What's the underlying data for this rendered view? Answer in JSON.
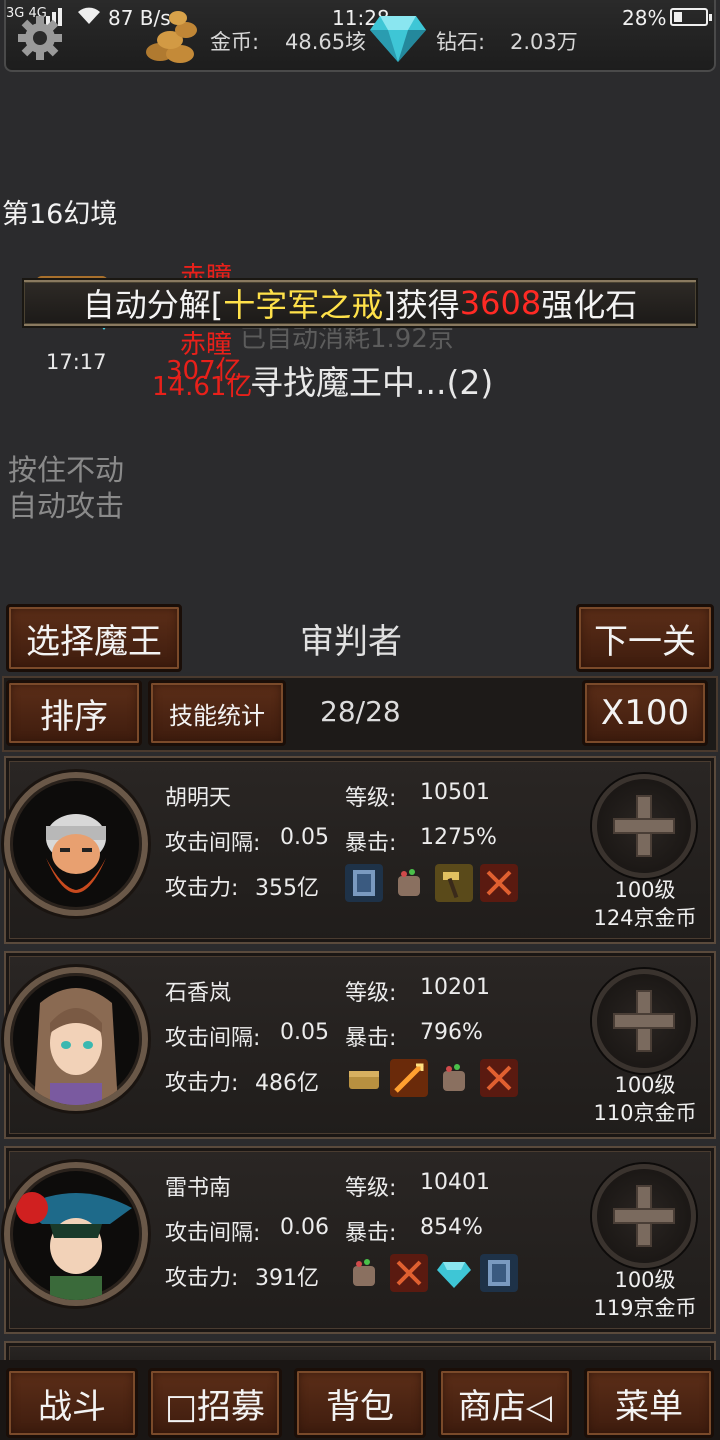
{
  "status": {
    "net": "3G 4G",
    "speed": "87 B/s",
    "time": "11:28",
    "battery": "28%"
  },
  "resources": {
    "gold_label": "金币:",
    "gold_value": "48.65垓",
    "gem_label": "钻石:",
    "gem_value": "2.03万"
  },
  "scene": {
    "level": "第16幻境",
    "chest_time": "17:17",
    "float_1": "赤瞳",
    "float_2": "赤瞳",
    "float_3": "307亿",
    "float_4": "14.61亿",
    "ghost": "已自动消耗1.92京",
    "notice_prefix": "自动分解[",
    "notice_item": "十字军之戒",
    "notice_mid": "]获得",
    "notice_amount": "3608",
    "notice_suffix": "强化石",
    "searching": "寻找魔王中...(2)",
    "hint_line1": "按住不动",
    "hint_line2": "自动攻击"
  },
  "boss": {
    "select_label": "选择魔王",
    "name": "审判者",
    "next_label": "下一关"
  },
  "toolbar": {
    "sort_label": "排序",
    "skills_label": "技能统计",
    "count": "28/28",
    "multiplier": "X100"
  },
  "labels": {
    "level": "等级:",
    "interval": "攻击间隔:",
    "crit": "暴击:",
    "attack": "攻击力:"
  },
  "heroes": [
    {
      "name": "胡明天",
      "level": "10501",
      "interval": "0.05",
      "crit": "1275%",
      "attack": "355亿",
      "upgrade_level": "100级",
      "upgrade_cost": "124京金币"
    },
    {
      "name": "石香岚",
      "level": "10201",
      "interval": "0.05",
      "crit": "796%",
      "attack": "486亿",
      "upgrade_level": "100级",
      "upgrade_cost": "110京金币"
    },
    {
      "name": "雷书南",
      "level": "10401",
      "interval": "0.06",
      "crit": "854%",
      "attack": "391亿",
      "upgrade_level": "100级",
      "upgrade_cost": "119京金币"
    }
  ],
  "nav": {
    "battle": "战斗",
    "recruit": "□招募",
    "bag": "背包",
    "shop": "商店◁",
    "menu": "菜单"
  },
  "colors": {
    "button_brown": "#5c2e18",
    "highlight_yellow": "#ffe14a",
    "highlight_red": "#ff2a24"
  }
}
